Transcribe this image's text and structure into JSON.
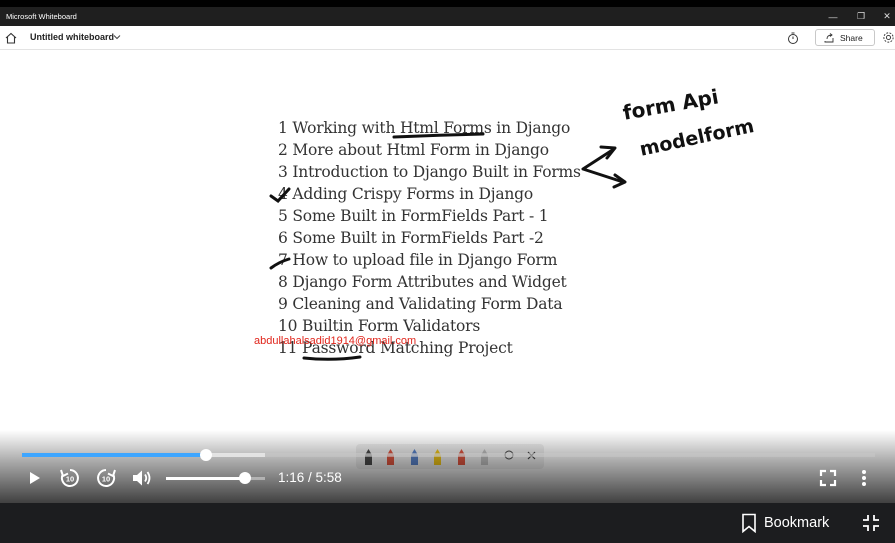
{
  "window": {
    "title": "Microsoft Whiteboard",
    "board_title": "Untitled whiteboard",
    "share_label": "Share"
  },
  "whiteboard": {
    "lines": [
      "1 Working with Html Forms in Django",
      "2 More about Html Form in Django",
      "3 Introduction to Django Built in Forms",
      "4 Adding Crispy Forms in Django",
      "5 Some Built in FormFields Part - 1",
      "6 Some Built in FormFields Part -2",
      "7 How to upload file in Django Form",
      "8 Django Form Attributes and Widget",
      "9 Cleaning and Validating Form Data",
      "10 Builtin Form Validators",
      "11 Password Matching Project"
    ],
    "annotations": [
      "form Api",
      "modelform"
    ],
    "watermark": "abdullahalsadid1914@gmail.com",
    "pen_colors": [
      "#3a3a3a",
      "#e0462e",
      "#4a79c8",
      "#f2c200",
      "#e0462e",
      "#bdbdbd"
    ]
  },
  "player": {
    "current_time": "1:16",
    "total_time": "5:58",
    "time_display": "1:16 / 5:58",
    "progress_fraction": 0.216,
    "buffered_fraction": 0.285,
    "volume_fraction": 0.8,
    "accent": "#3ea6ff"
  },
  "footer": {
    "bookmark_label": "Bookmark"
  }
}
